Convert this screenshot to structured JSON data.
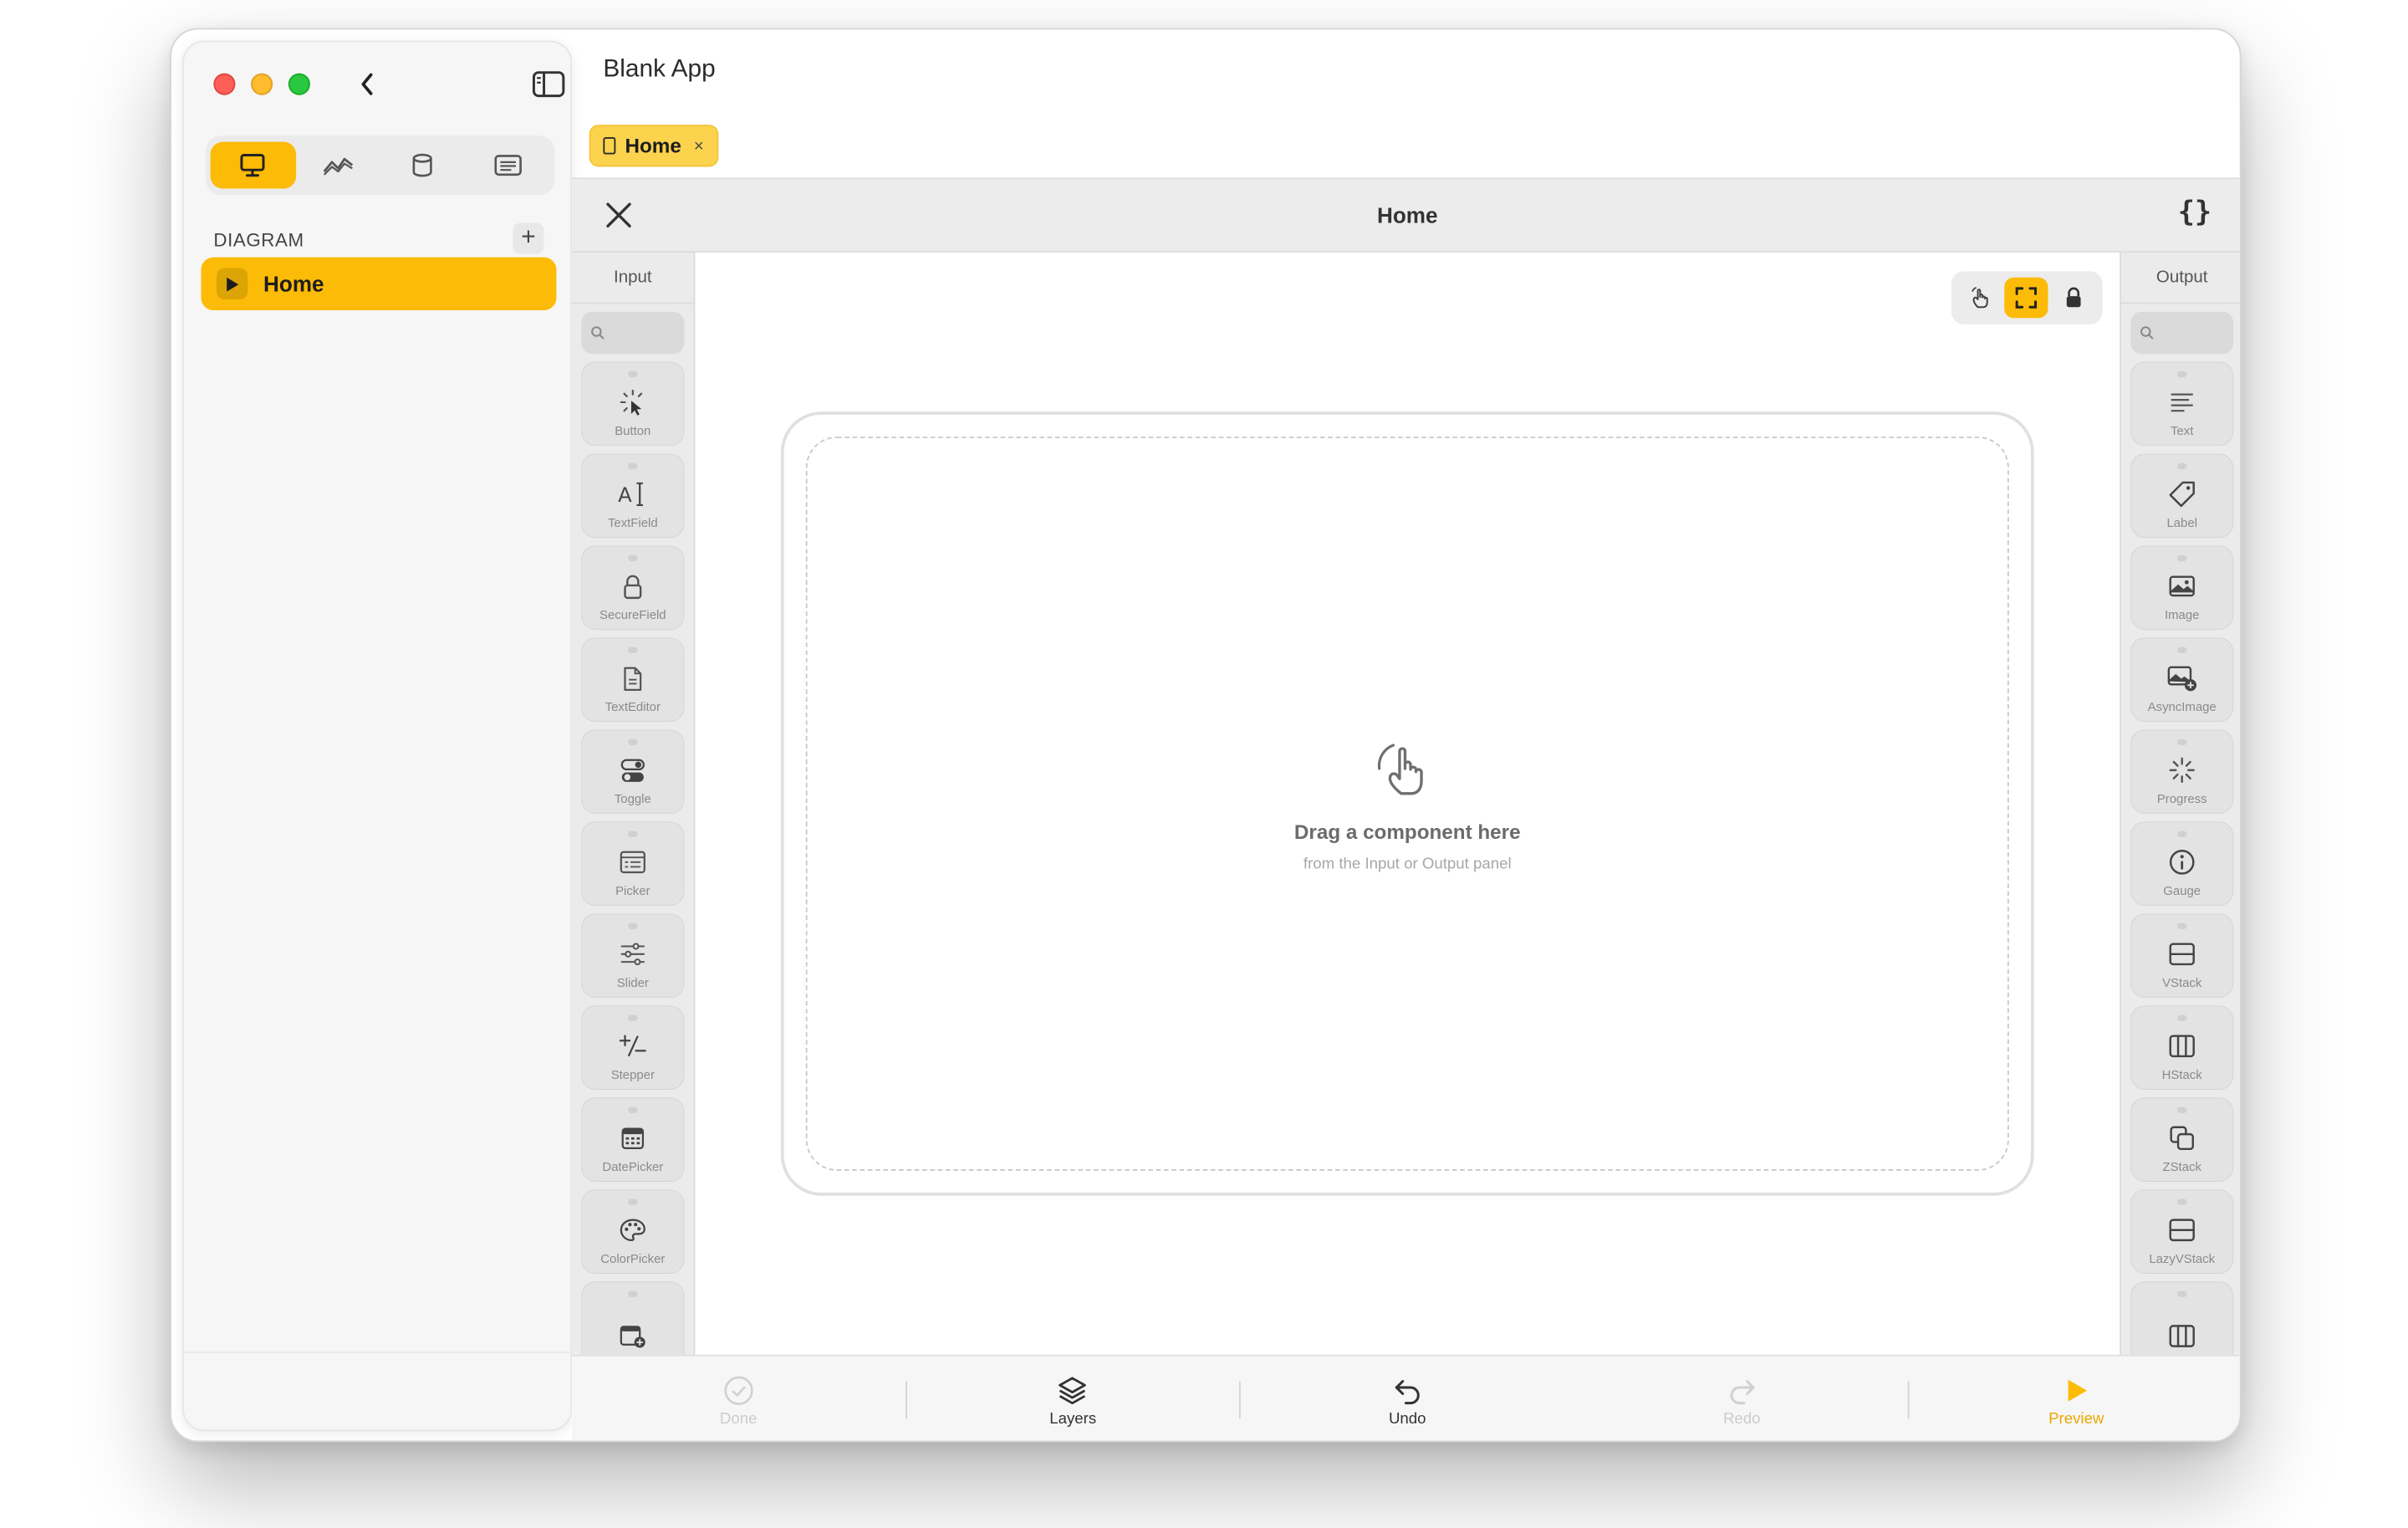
{
  "app": {
    "title": "Blank App"
  },
  "sidebar": {
    "section_label": "DIAGRAM",
    "add_label": "+",
    "items": [
      {
        "label": "Home"
      }
    ],
    "segments": [
      "desktop-icon",
      "chart-icon",
      "database-icon",
      "list-icon"
    ]
  },
  "tabs": [
    {
      "label": "Home",
      "close": "×"
    }
  ],
  "editor": {
    "title": "Home",
    "code_label": "{}",
    "input_panel": {
      "title": "Input",
      "components": [
        {
          "label": "Button",
          "icon": "button-icon"
        },
        {
          "label": "TextField",
          "icon": "textfield-icon"
        },
        {
          "label": "SecureField",
          "icon": "lock-icon"
        },
        {
          "label": "TextEditor",
          "icon": "document-icon"
        },
        {
          "label": "Toggle",
          "icon": "toggle-icon"
        },
        {
          "label": "Picker",
          "icon": "picker-icon"
        },
        {
          "label": "Slider",
          "icon": "slider-icon"
        },
        {
          "label": "Stepper",
          "icon": "stepper-icon"
        },
        {
          "label": "DatePicker",
          "icon": "calendar-icon"
        },
        {
          "label": "ColorPicker",
          "icon": "palette-icon"
        },
        {
          "label": "",
          "icon": "calendar-plus-icon"
        }
      ]
    },
    "output_panel": {
      "title": "Output",
      "components": [
        {
          "label": "Text",
          "icon": "text-lines-icon"
        },
        {
          "label": "Label",
          "icon": "tag-icon"
        },
        {
          "label": "Image",
          "icon": "image-icon"
        },
        {
          "label": "AsyncImage",
          "icon": "async-image-icon"
        },
        {
          "label": "Progress",
          "icon": "spinner-icon"
        },
        {
          "label": "Gauge",
          "icon": "gauge-icon"
        },
        {
          "label": "VStack",
          "icon": "vstack-icon"
        },
        {
          "label": "HStack",
          "icon": "hstack-icon"
        },
        {
          "label": "ZStack",
          "icon": "zstack-icon"
        },
        {
          "label": "LazyVStack",
          "icon": "lazy-vstack-icon"
        },
        {
          "label": "",
          "icon": "lazy-hstack-icon"
        }
      ]
    },
    "canvas": {
      "hint_title": "Drag a component here",
      "hint_subtitle": "from the Input or Output panel",
      "tools": [
        "hand-gesture-icon",
        "fullscreen-icon",
        "lock-icon"
      ]
    },
    "bottom_bar": {
      "done": "Done",
      "layers": "Layers",
      "undo": "Undo",
      "redo": "Redo",
      "preview": "Preview"
    }
  },
  "colors": {
    "accent": "#fcbb06",
    "tab_bg": "#fcd34d",
    "panel_bg": "#ebebeb"
  }
}
